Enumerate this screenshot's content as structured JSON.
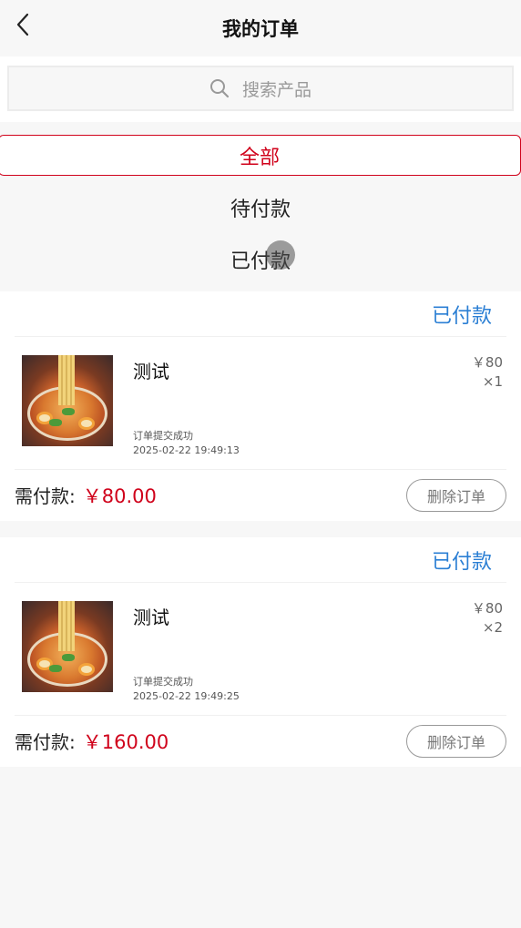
{
  "header": {
    "title": "我的订单"
  },
  "search": {
    "placeholder": "搜索产品"
  },
  "filters": [
    {
      "label": "全部",
      "active": true
    },
    {
      "label": "待付款",
      "active": false
    },
    {
      "label": "已付款",
      "active": false
    }
  ],
  "orders": [
    {
      "status": "已付款",
      "product_name": "测试",
      "price": "￥80",
      "quantity": "×1",
      "message": "订单提交成功",
      "time": "2025-02-22 19:49:13",
      "pay_label": "需付款:",
      "pay_amount": "￥80.00",
      "delete_label": "删除订单"
    },
    {
      "status": "已付款",
      "product_name": "测试",
      "price": "￥80",
      "quantity": "×2",
      "message": "订单提交成功",
      "time": "2025-02-22 19:49:25",
      "pay_label": "需付款:",
      "pay_amount": "￥160.00",
      "delete_label": "删除订单"
    }
  ],
  "colors": {
    "accent_red": "#d0021b",
    "status_blue": "#2b7fd4"
  },
  "icons": {
    "back": "chevron-left-icon",
    "search": "search-icon",
    "product_image": "noodle-bowl-image"
  }
}
